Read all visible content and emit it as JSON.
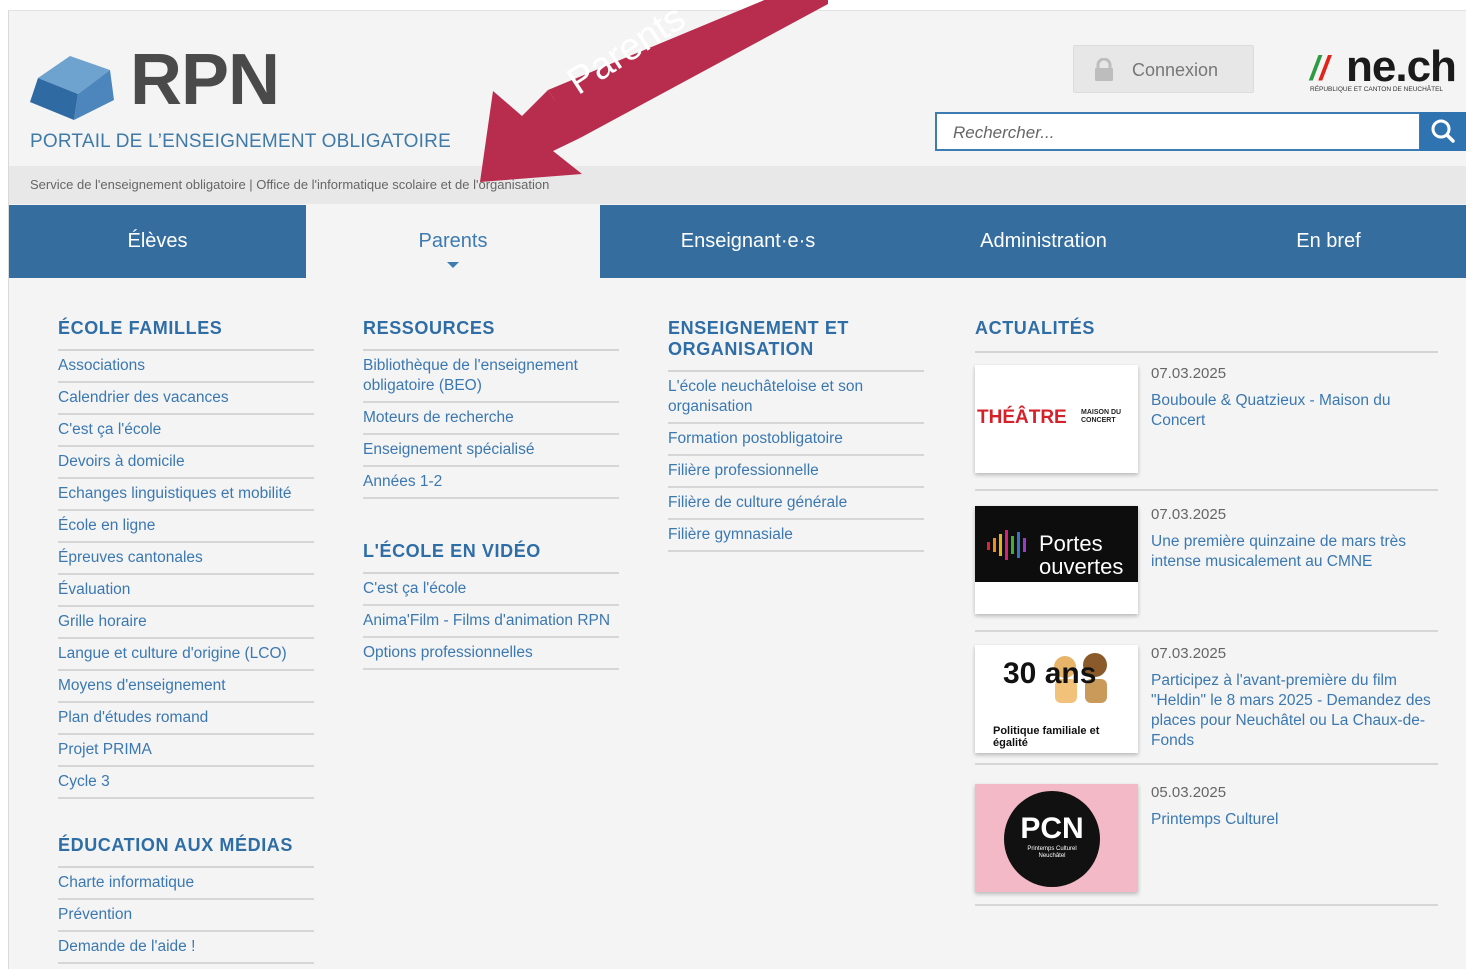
{
  "header": {
    "brand": "RPN",
    "tagline": "PORTAIL DE L’ENSEIGNEMENT OBLIGATOIRE",
    "service_line": "Service de l'enseignement obligatoire | Office de l'informatique scolaire et de l'organisation",
    "login_label": "Connexion",
    "ne_logo_word": "ne.ch",
    "ne_logo_sub": "RÉPUBLIQUE ET CANTON DE NEUCHÂTEL",
    "search_placeholder": "Rechercher..."
  },
  "nav": {
    "tabs": [
      {
        "label": "Élèves"
      },
      {
        "label": "Parents"
      },
      {
        "label": "Enseignant·e·s"
      },
      {
        "label": "Administration"
      },
      {
        "label": "En bref"
      }
    ]
  },
  "annotation": {
    "label": "Parents",
    "color": "#b82c4d"
  },
  "colors": {
    "accent": "#356d9f",
    "link": "#3b78b1",
    "heading": "#2f6da6"
  },
  "menu": {
    "ecole_familles": {
      "heading": "ÉCOLE FAMILLES",
      "items": [
        "Associations",
        "Calendrier des vacances",
        "C'est ça l'école",
        "Devoirs à domicile",
        "Echanges linguistiques et mobilité",
        "École en ligne",
        "Épreuves cantonales",
        "Évaluation",
        "Grille horaire",
        "Langue et culture d'origine (LCO)",
        "Moyens d'enseignement",
        "Plan d'études romand",
        "Projet PRIMA",
        "Cycle 3"
      ]
    },
    "education_medias": {
      "heading": "ÉDUCATION AUX MÉDIAS",
      "items": [
        "Charte informatique",
        "Prévention",
        "Demande de l'aide !"
      ]
    },
    "ressources": {
      "heading": "RESSOURCES",
      "items": [
        "Bibliothèque de l'enseignement obligatoire (BEO)",
        "Moteurs de recherche",
        "Enseignement spécialisé",
        "Années 1-2"
      ]
    },
    "ecole_video": {
      "heading": "L'ÉCOLE EN VIDÉO",
      "items": [
        "C'est ça l'école",
        "Anima'Film - Films d'animation RPN",
        "Options professionnelles"
      ]
    },
    "enseignement": {
      "heading": "ENSEIGNEMENT ET ORGANISATION",
      "items": [
        "L'école neuchâteloise et son organisation",
        "Formation postobligatoire",
        "Filière professionnelle",
        "Filière de culture générale",
        "Filière gymnasiale"
      ]
    }
  },
  "news": {
    "heading": "ACTUALITÉS",
    "items": [
      {
        "date": "07.03.2025",
        "title": "Bouboule & Quatzieux - Maison du Concert",
        "thumb_text": "THÉÂTRE",
        "thumb_text2": "MAISON DU CONCERT"
      },
      {
        "date": "07.03.2025",
        "title": "Une première quinzaine de mars très intense musicalement au CMNE",
        "thumb_text": "Portes",
        "thumb_text2": "ouvertes"
      },
      {
        "date": "07.03.2025",
        "title": "Participez à l'avant-première du film \"Heldin\" le 8 mars 2025 - Demandez des places pour Neuchâtel ou La Chaux-de-Fonds",
        "thumb_text": "30 ans",
        "thumb_text2": "Politique familiale et égalité"
      },
      {
        "date": "05.03.2025",
        "title": "Printemps Culturel",
        "thumb_text": "PCN",
        "thumb_text2": "Printemps Culturel Neuchâtel"
      }
    ]
  }
}
